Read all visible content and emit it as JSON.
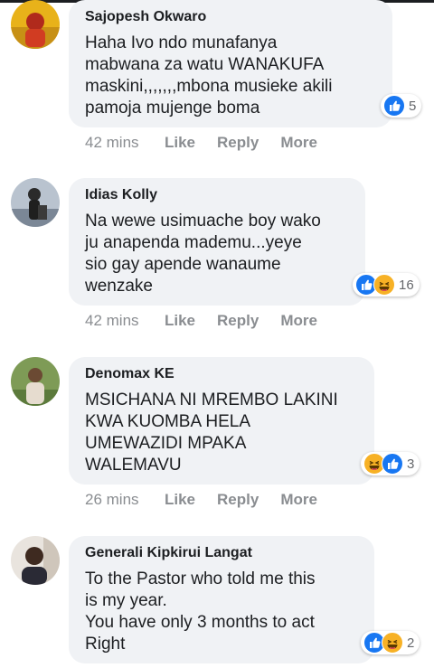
{
  "comments": [
    {
      "author": "Sajopesh Okwaro",
      "text": "Haha Ivo ndo munafanya\nmabwana za watu WANAKUFA\nmaskini,,,,,,,mbona musieke akili\npamoja mujenge boma",
      "reactions": [
        "like"
      ],
      "reaction_count": "5",
      "time": "42 mins",
      "like_label": "Like",
      "reply_label": "Reply",
      "more_label": "More"
    },
    {
      "author": "Idias Kolly",
      "text": "Na wewe usimuache boy wako\nju anapenda mademu...yeye\nsio gay apende wanaume\nwenzake",
      "reactions": [
        "like",
        "haha"
      ],
      "reaction_count": "16",
      "time": "42 mins",
      "like_label": "Like",
      "reply_label": "Reply",
      "more_label": "More"
    },
    {
      "author": "Denomax KE",
      "text": "MSICHANA NI MREMBO LAKINI\nKWA KUOMBA HELA\nUMEWAZIDI MPAKA\nWALEMAVU",
      "reactions": [
        "haha",
        "like"
      ],
      "reaction_count": "3",
      "time": "26 mins",
      "like_label": "Like",
      "reply_label": "Reply",
      "more_label": "More"
    },
    {
      "author": "Generali Kipkirui Langat",
      "text": "To the Pastor who told me this\nis my year.\nYou have only 3 months to act\nRight",
      "reactions": [
        "like",
        "haha"
      ],
      "reaction_count": "2"
    }
  ],
  "colors": {
    "bubble": "#f0f2f5",
    "like_blue": "#1877f2",
    "haha_yellow": "#f7b125",
    "meta_gray": "#8a8d91"
  }
}
